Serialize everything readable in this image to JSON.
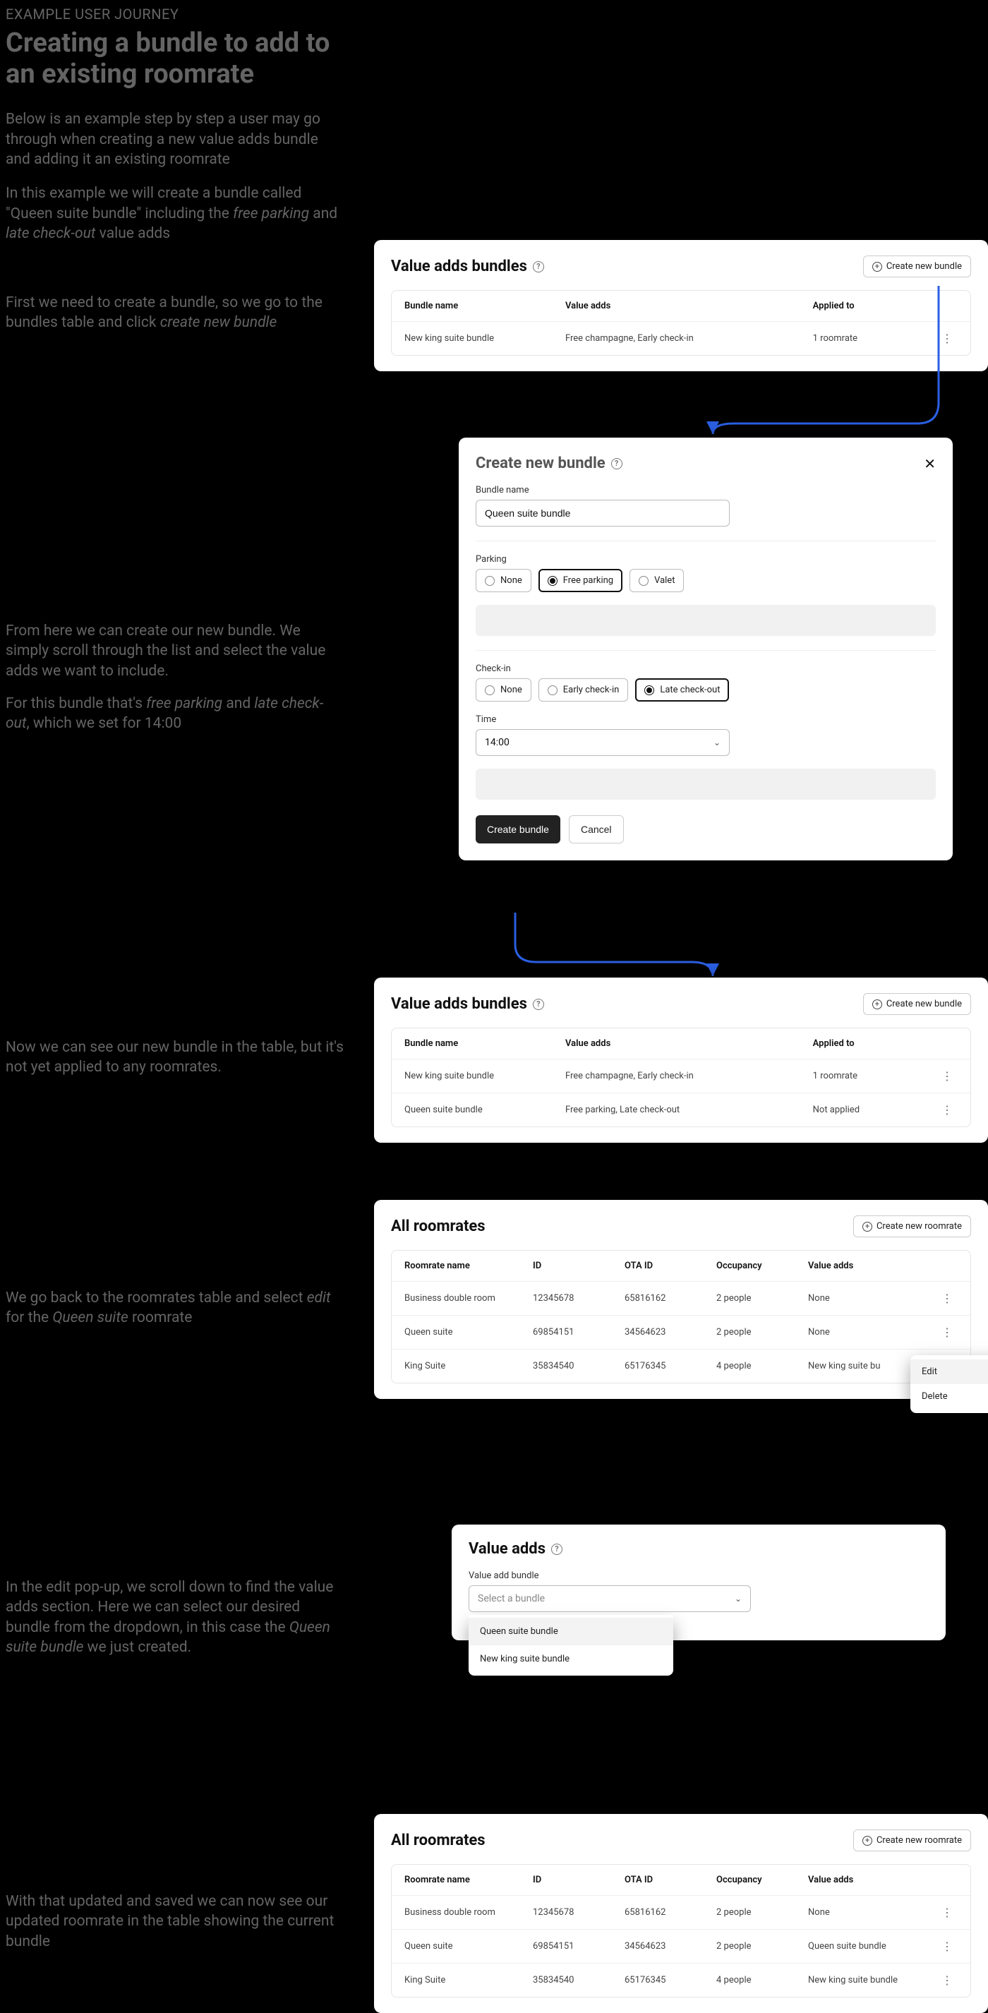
{
  "eyebrow": "EXAMPLE USER JOURNEY",
  "title": "Creating a bundle to add to an existing roomrate",
  "intro1": "Below is an example step by step a user may go through when creating a new value adds bundle and adding it an existing roomrate",
  "intro2_a": "In this example we will create a bundle called \"Queen suite bundle\" including the ",
  "intro2_i1": "free parking",
  "intro2_mid": " and ",
  "intro2_i2": "late check-out",
  "intro2_b": " value adds",
  "cap1_a": "First we need to create a bundle, so we go to the bundles table and click ",
  "cap1_i": "create new bundle",
  "cap2_a": "From here we can create our new bundle. We simply scroll through the list and select the value adds we want to include.",
  "cap2_b1": "For this bundle that's ",
  "cap2_i1": "free parking",
  "cap2_mid": " and ",
  "cap2_i2": "late check-out",
  "cap2_b2": ", which we set for 14:00",
  "cap3": "Now we can see our new bundle in the table, but it's not yet applied to any roomrates.",
  "cap4_a": "We go back to the roomrates table and select ",
  "cap4_i1": "edit",
  "cap4_mid": " for the ",
  "cap4_i2": "Queen suite",
  "cap4_b": " roomrate",
  "cap5_a": "In the edit pop-up, we scroll down to find the value adds section. Here we can select our desired bundle from the dropdown, in this case the ",
  "cap5_i": "Queen suite bundle",
  "cap5_b": " we just created.",
  "cap6": "With that updated and saved we can now see our updated roomrate in the table showing the current bundle",
  "bundles": {
    "title": "Value adds bundles",
    "create": "Create new bundle",
    "headers": {
      "name": "Bundle name",
      "adds": "Value adds",
      "applied": "Applied to"
    },
    "row1": {
      "name": "New king suite bundle",
      "adds": "Free champagne, Early check-in",
      "applied": "1 roomrate"
    },
    "row2": {
      "name": "Queen suite bundle",
      "adds": "Free parking, Late check-out",
      "applied": "Not applied"
    }
  },
  "modal": {
    "title": "Create new bundle",
    "bundle_name_label": "Bundle name",
    "bundle_name_value": "Queen suite bundle",
    "parking_label": "Parking",
    "parking": {
      "none": "None",
      "free": "Free parking",
      "valet": "Valet"
    },
    "checkin_label": "Check-in",
    "checkin": {
      "none": "None",
      "early": "Early check-in",
      "late": "Late check-out"
    },
    "time_label": "Time",
    "time_value": "14:00",
    "create": "Create bundle",
    "cancel": "Cancel"
  },
  "rooms": {
    "title": "All roomrates",
    "create": "Create new roomrate",
    "headers": {
      "name": "Roomrate name",
      "id": "ID",
      "ota": "OTA ID",
      "occ": "Occupancy",
      "adds": "Value adds"
    },
    "r1": {
      "name": "Business double room",
      "id": "12345678",
      "ota": "65816162",
      "occ": "2 people",
      "adds": "None"
    },
    "r2_before": {
      "name": "Queen suite",
      "id": "69854151",
      "ota": "34564623",
      "occ": "2 people",
      "adds": "None"
    },
    "r2_after": {
      "name": "Queen suite",
      "id": "69854151",
      "ota": "34564623",
      "occ": "2 people",
      "adds": "Queen suite bundle"
    },
    "r3_trunc": {
      "name": "King Suite",
      "id": "35834540",
      "ota": "65176345",
      "occ": "4 people",
      "adds": "New king suite bu"
    },
    "r3": {
      "name": "King Suite",
      "id": "35834540",
      "ota": "65176345",
      "occ": "4 people",
      "adds": "New king suite bundle"
    }
  },
  "menu": {
    "edit": "Edit",
    "delete": "Delete"
  },
  "va_section": {
    "title": "Value adds",
    "label": "Value add bundle",
    "placeholder": "Select a bundle",
    "opt1": "Queen suite bundle",
    "opt2": "New king suite bundle"
  }
}
